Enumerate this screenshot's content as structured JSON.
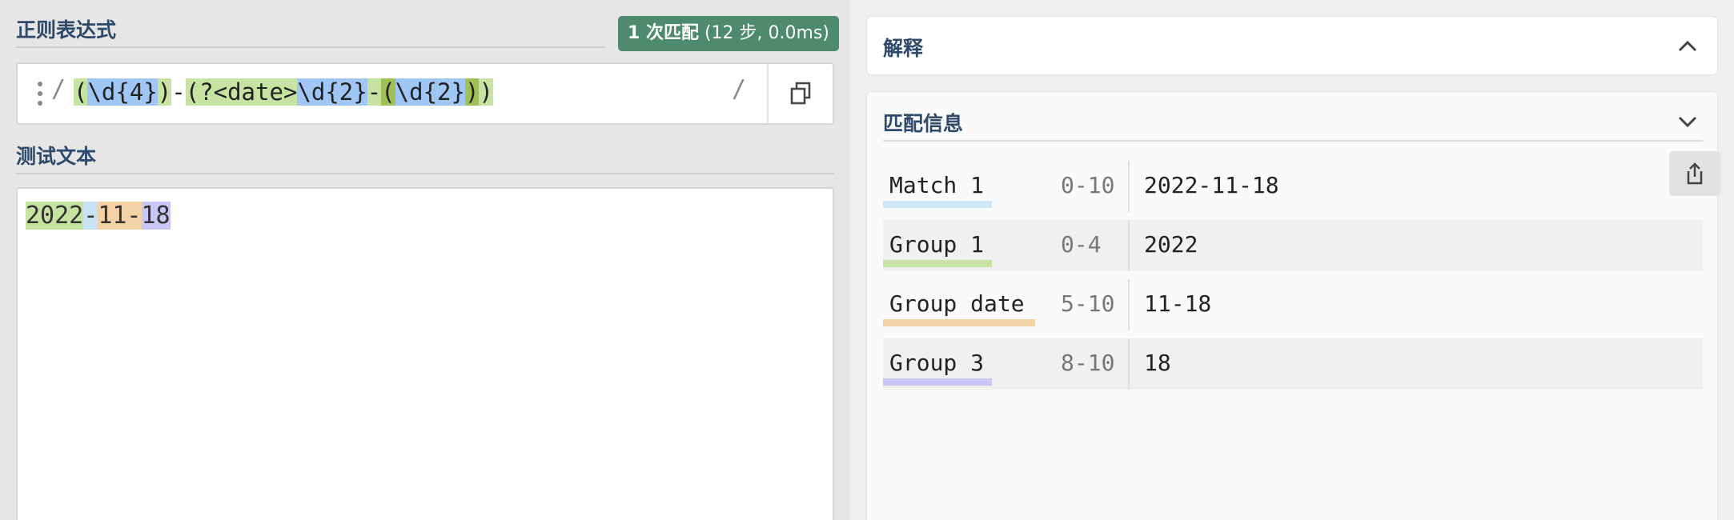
{
  "regex_section": {
    "title": "正则表达式",
    "match_badge": {
      "count": "1 次匹配",
      "detail": " (12 步, 0.0ms)"
    },
    "delimiter_open": "/",
    "delimiter_close": "/",
    "tokens": [
      {
        "text": "(",
        "hl": "tg"
      },
      {
        "text": "\\d{4}",
        "hl": "tb"
      },
      {
        "text": ")",
        "hl": "tg"
      },
      {
        "text": "-",
        "hl": ""
      },
      {
        "text": "(?<date>",
        "hl": "tg"
      },
      {
        "text": "\\d{2}",
        "hl": "tb"
      },
      {
        "text": "-",
        "hl": "tg"
      },
      {
        "text": "(",
        "hl": "tgd"
      },
      {
        "text": "\\d{2}",
        "hl": "tb"
      },
      {
        "text": ")",
        "hl": "tgd"
      },
      {
        "text": ")",
        "hl": "tg"
      }
    ],
    "icons": {
      "drag": "drag-handle-icon",
      "copy": "copy-icon"
    }
  },
  "test_section": {
    "title": "测试文本",
    "segments": [
      {
        "text": "2022",
        "hl": "hl-g1"
      },
      {
        "text": "-",
        "hl": "hl-m"
      },
      {
        "text": "11-",
        "hl": "hl-d"
      },
      {
        "text": "18",
        "hl": "hl-g3"
      }
    ]
  },
  "explanation": {
    "title": "解释",
    "toggle_icon": "chevron-up-icon"
  },
  "match_info": {
    "title": "匹配信息",
    "toggle_icon": "chevron-down-icon",
    "share_icon": "share-icon",
    "rows": [
      {
        "name": "Match 1",
        "range": "0-10",
        "value": "2022-11-18",
        "color": "#cfe6f6"
      },
      {
        "name": "Group 1",
        "range": "0-4",
        "value": "2022",
        "color": "#c6e3a1"
      },
      {
        "name": "Group date",
        "range": "5-10",
        "value": "11-18",
        "color": "#f5d1a6"
      },
      {
        "name": "Group 3",
        "range": "8-10",
        "value": "18",
        "color": "#c9c6f6"
      }
    ]
  }
}
